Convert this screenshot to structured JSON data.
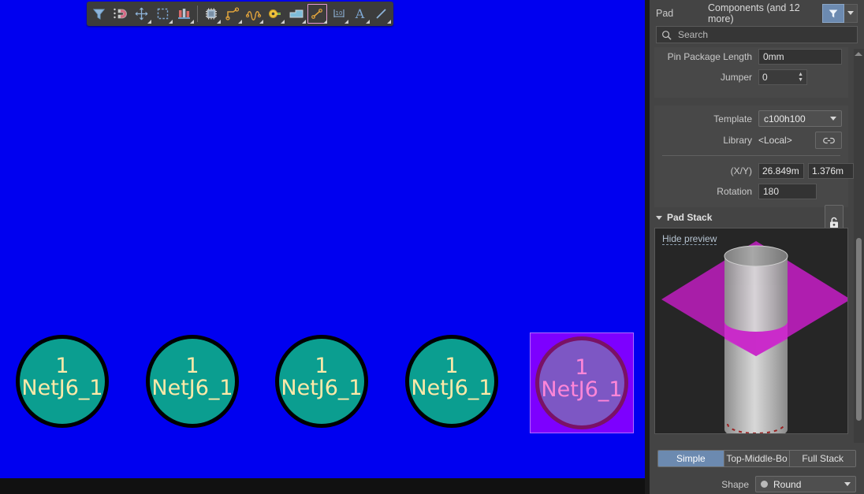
{
  "canvas": {
    "background_color": "#0000f0",
    "pad_fill_color": "#0b9e90",
    "pad_outline_color": "#000000",
    "pad_text_color": "#ffe9a8",
    "selected_pad_fill_color": "#7d57c4",
    "selected_pad_outline_color": "#7a1266",
    "selected_pad_text_color": "#ff86d8",
    "selection_box_color": "#7d00ff",
    "pads": [
      {
        "designator": "1",
        "net": "NetJ6_1",
        "selected": false
      },
      {
        "designator": "1",
        "net": "NetJ6_1",
        "selected": false
      },
      {
        "designator": "1",
        "net": "NetJ6_1",
        "selected": false
      },
      {
        "designator": "1",
        "net": "NetJ6_1",
        "selected": false
      },
      {
        "designator": "1",
        "net": "NetJ6_1",
        "selected": true
      }
    ]
  },
  "toolbar": {
    "items": [
      {
        "name": "filter-tool",
        "icon": "funnel-icon",
        "has_dropdown": false,
        "framed": false
      },
      {
        "name": "magnet-snap-tool",
        "icon": "magnet-icon",
        "has_dropdown": false,
        "framed": false
      },
      {
        "name": "move-tool",
        "icon": "move-crosshair-icon",
        "has_dropdown": true,
        "framed": false
      },
      {
        "name": "area-select-tool",
        "icon": "marquee-select-icon",
        "has_dropdown": true,
        "framed": false
      },
      {
        "name": "place-component-tool",
        "icon": "components-icon",
        "has_dropdown": true,
        "framed": false
      },
      {
        "name": "place-footprint-tool",
        "icon": "chip-icon",
        "has_dropdown": true,
        "framed": false
      },
      {
        "name": "route-track-tool",
        "icon": "route-track-icon",
        "has_dropdown": true,
        "framed": false
      },
      {
        "name": "tune-length-tool",
        "icon": "accordion-tune-icon",
        "has_dropdown": true,
        "framed": false
      },
      {
        "name": "place-via-tool",
        "icon": "via-icon",
        "has_dropdown": true,
        "framed": false
      },
      {
        "name": "place-polygon-tool",
        "icon": "polygon-pour-icon",
        "has_dropdown": true,
        "framed": false
      },
      {
        "name": "place-pad-tool",
        "icon": "pad-line-icon",
        "has_dropdown": true,
        "framed": true
      },
      {
        "name": "place-dimension-tool",
        "icon": "dimension-icon",
        "has_dropdown": true,
        "framed": false
      },
      {
        "name": "place-text-tool",
        "icon": "text-a-icon",
        "has_dropdown": true,
        "framed": false
      },
      {
        "name": "place-line-tool",
        "icon": "line-icon",
        "has_dropdown": true,
        "framed": false
      }
    ]
  },
  "panel": {
    "object_type": "Pad",
    "selection_summary": "Components (and 12 more)",
    "search": {
      "placeholder": "Search",
      "value": ""
    },
    "properties": {
      "pin_package_length": {
        "label": "Pin Package Length",
        "value": "0mm"
      },
      "jumper": {
        "label": "Jumper",
        "value": "0"
      },
      "template": {
        "label": "Template",
        "value": "c100h100"
      },
      "library": {
        "label": "Library",
        "value": "<Local>"
      },
      "position": {
        "label": "(X/Y)",
        "x": "26.849m",
        "y": "1.376m"
      },
      "rotation": {
        "label": "Rotation",
        "value": "180"
      }
    },
    "pad_stack": {
      "title": "Pad Stack",
      "hide_preview_label": "Hide preview",
      "preview_pad_color": "#b51fb5",
      "preview_barrel_color": "#b9b9b9",
      "modes": [
        {
          "label": "Simple",
          "active": true
        },
        {
          "label": "Top-Middle-Bo",
          "active": false
        },
        {
          "label": "Full Stack",
          "active": false
        }
      ],
      "shape": {
        "label": "Shape",
        "value": "Round"
      }
    }
  }
}
